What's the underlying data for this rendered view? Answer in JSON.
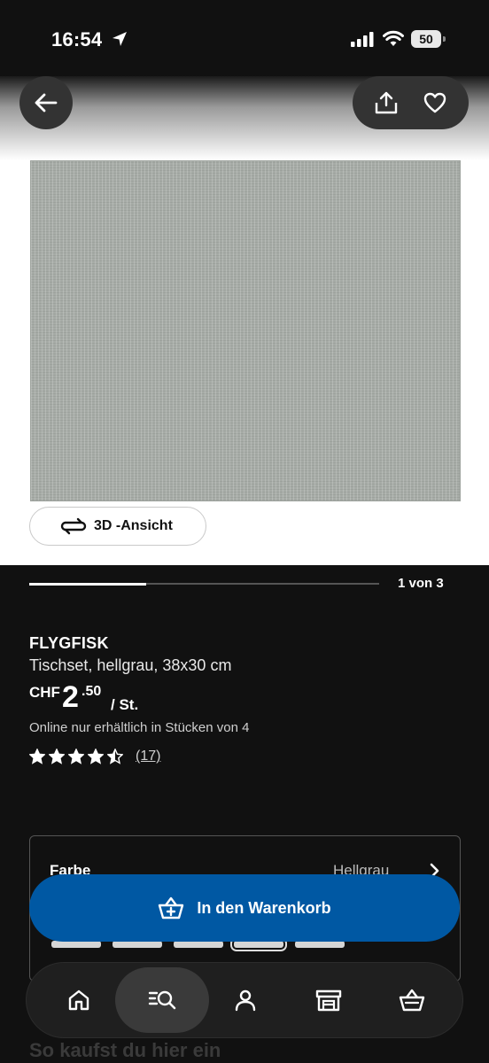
{
  "status_bar": {
    "time": "16:54",
    "battery": "50",
    "icons": [
      "location-arrow-icon",
      "signal-icon",
      "wifi-icon",
      "battery-icon"
    ]
  },
  "top_actions": {
    "back_icon": "arrow-left-icon",
    "share_icon": "share-icon",
    "favorite_icon": "heart-icon"
  },
  "gallery": {
    "view_3d_label": "3D -Ansicht",
    "view_3d_icon": "rotate-3d-icon",
    "page_indicator": "1 von 3",
    "progress_fraction": 0.333
  },
  "product": {
    "name": "FLYGFISK",
    "description": "Tischset, hellgrau, 38x30 cm",
    "price_currency": "CHF",
    "price_integer": "2",
    "price_decimal": ".50",
    "price_unit": "/ St.",
    "availability": "Online nur erhältlich in Stücken von 4",
    "rating_value": 4.5,
    "rating_max": 5,
    "review_count": "(17)"
  },
  "color_selector": {
    "label": "Farbe",
    "value": "Hellgrau",
    "swatch_count": 5,
    "selected_swatch": 4
  },
  "cart": {
    "label": "In den Warenkorb",
    "icon": "basket-plus-icon"
  },
  "bottom_nav": {
    "items": [
      "home-icon",
      "search-icon",
      "profile-icon",
      "store-icon",
      "basket-icon"
    ],
    "active": "search-icon"
  },
  "section": {
    "how_to_buy": "So kaufst du hier ein"
  },
  "colors": {
    "background": "#111111",
    "ikea_blue": "#0058a3",
    "card_border": "#555555",
    "product_grey": "#a7aca7"
  }
}
